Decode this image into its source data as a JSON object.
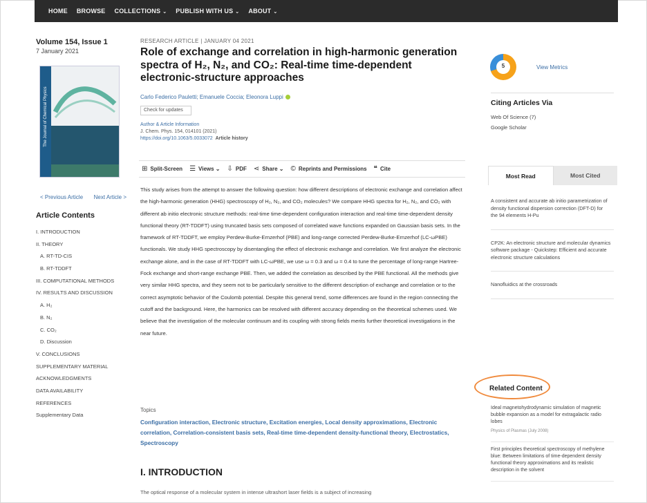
{
  "nav": {
    "items": [
      {
        "label": "HOME",
        "caret": ""
      },
      {
        "label": "BROWSE",
        "caret": ""
      },
      {
        "label": "COLLECTIONS",
        "caret": "⌄"
      },
      {
        "label": "PUBLISH WITH US",
        "caret": "⌄"
      },
      {
        "label": "ABOUT",
        "caret": "⌄"
      }
    ]
  },
  "issue": {
    "volume": "Volume 154, Issue 1",
    "date": "7 January 2021",
    "cover_label": "The Journal of Chemical Physics",
    "prev": "< Previous Article",
    "next": "Next Article >"
  },
  "article_contents": {
    "title": "Article Contents",
    "items": [
      {
        "label": "I. INTRODUCTION",
        "indent": false
      },
      {
        "label": "II. THEORY",
        "indent": false
      },
      {
        "label": "A. RT-TD-CIS",
        "indent": true
      },
      {
        "label": "B. RT-TDDFT",
        "indent": true
      },
      {
        "label": "III. COMPUTATIONAL METHODS",
        "indent": false
      },
      {
        "label": "IV. RESULTS AND DISCUSSION",
        "indent": false
      },
      {
        "label": "A. H₂",
        "indent": true
      },
      {
        "label": "B. N₂",
        "indent": true
      },
      {
        "label": "C. CO₂",
        "indent": true
      },
      {
        "label": "D. Discussion",
        "indent": true
      },
      {
        "label": "V. CONCLUSIONS",
        "indent": false
      },
      {
        "label": "SUPPLEMENTARY MATERIAL",
        "indent": false
      },
      {
        "label": "ACKNOWLEDGMENTS",
        "indent": false
      },
      {
        "label": "DATA AVAILABILITY",
        "indent": false
      },
      {
        "label": "REFERENCES",
        "indent": false
      },
      {
        "label": "Supplementary Data",
        "indent": false
      }
    ]
  },
  "article": {
    "kicker": "RESEARCH ARTICLE | JANUARY 04 2021",
    "title": "Role of exchange and correlation in high-harmonic generation spectra of H₂, N₂, and CO₂: Real-time time-dependent electronic-structure approaches",
    "authors": "Carlo Federico Pauletti; Emanuele Coccia; Eleonora Luppi",
    "check_updates": "Check for updates",
    "meta_line1": "Author & Article Information",
    "meta_line2": "J. Chem. Phys. 154, 014101 (2021)",
    "doi": "https://doi.org/10.1063/5.0033072",
    "article_history": "Article history"
  },
  "toolbar": {
    "items": [
      {
        "icon": "⊞",
        "label": "Split-Screen",
        "name": "split-screen-button"
      },
      {
        "icon": "☰",
        "label": "Views ⌄",
        "name": "views-button"
      },
      {
        "icon": "⇩",
        "label": "PDF",
        "name": "pdf-button"
      },
      {
        "icon": "⋖",
        "label": "Share ⌄",
        "name": "share-button"
      },
      {
        "icon": "©",
        "label": "Reprints and Permissions",
        "name": "reprints-button"
      },
      {
        "icon": "❝",
        "label": "Cite",
        "name": "cite-button"
      }
    ]
  },
  "abstract": "This study arises from the attempt to answer the following question: how different descriptions of electronic exchange and correlation affect the high-harmonic generation (HHG) spectroscopy of H₂, N₂, and CO₂ molecules? We compare HHG spectra for H₂, N₂, and CO₂ with different ab initio electronic structure methods: real-time time-dependent configuration interaction and real-time time-dependent density functional theory (RT-TDDFT) using truncated basis sets composed of correlated wave functions expanded on Gaussian basis sets. In the framework of RT-TDDFT, we employ Perdew-Burke-Ernzerhof (PBE) and long-range corrected Perdew-Burke-Ernzerhof (LC-ωPBE) functionals. We study HHG spectroscopy by disentangling the effect of electronic exchange and correlation. We first analyze the electronic exchange alone, and in the case of RT-TDDFT with LC-ωPBE, we use ω = 0.3 and ω = 0.4 to tune the percentage of long-range Hartree-Fock exchange and short-range exchange PBE. Then, we added the correlation as described by the PBE functional. All the methods give very similar HHG spectra, and they seem not to be particularly sensitive to the different description of exchange and correlation or to the correct asymptotic behavior of the Coulomb potential. Despite this general trend, some differences are found in the region connecting the cutoff and the background. Here, the harmonics can be resolved with different accuracy depending on the theoretical schemes used. We believe that the investigation of the molecular continuum and its coupling with strong fields merits further theoretical investigations in the near future.",
  "topics": {
    "label": "Topics",
    "text": "Configuration interaction, Electronic structure, Excitation energies, Local density approximations, Electronic correlation, Correlation-consistent basis sets, Real-time time-dependent density-functional theory, Electrostatics, Spectroscopy"
  },
  "section": {
    "heading": "I. INTRODUCTION",
    "first_line": "The optical response of a molecular system in intense ultrashort laser fields is a subject of increasing"
  },
  "sidebar": {
    "altmetric_score": "5",
    "view_metrics": "View Metrics",
    "citing_title": "Citing Articles Via",
    "citing_wos": "Web Of Science (7)",
    "citing_scholar": "Google Scholar",
    "tab_most_read": "Most Read",
    "tab_most_cited": "Most Cited",
    "most_read": [
      "A consistent and accurate ab initio parametrization of density functional dispersion correction (DFT-D) for the 94 elements H-Pu",
      "CP2K: An electronic structure and molecular dynamics software package - Quickstep: Efficient and accurate electronic structure calculations",
      "Nanofluidics at the crossroads"
    ],
    "related_title": "Related Content",
    "related": [
      {
        "title": "Ideal magnetohydrodynamic simulation of magnetic bubble expansion as a model for extragalactic radio lobes",
        "source": "Physics of Plasmas (July 2008)"
      },
      {
        "title": "First principles theoretical spectroscopy of methylene blue: Between limitations of time-dependent density functional theory approximations and its realistic description in the solvent",
        "source": ""
      }
    ]
  },
  "colors": {
    "accent_link": "#3b6ea5",
    "nav_bg": "#2b2b2b",
    "highlight_oval": "#f08a3c"
  }
}
